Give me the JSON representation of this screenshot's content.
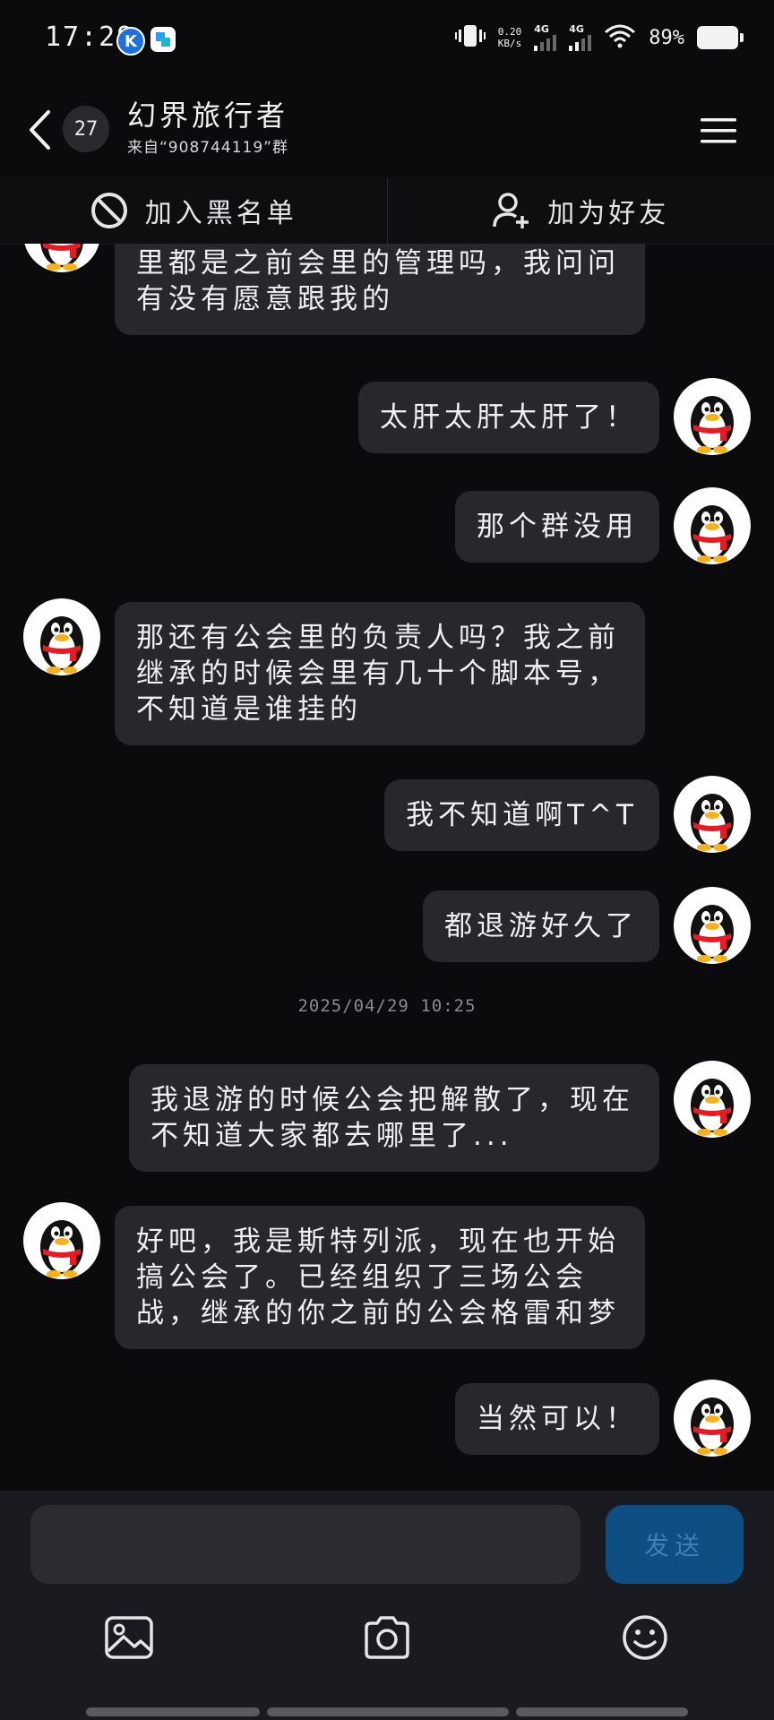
{
  "status_bar": {
    "time": "17:29",
    "net_speed_value": "0.20",
    "net_speed_unit": "KB/s",
    "network_1": "4G",
    "network_2": "4G",
    "battery": "89%"
  },
  "header": {
    "unread_count": "27",
    "title": "幻界旅行者",
    "subtitle": "来自“908744119”群"
  },
  "actions": {
    "block_label": "加入黑名单",
    "add_friend_label": "加为好友"
  },
  "messages": [
    {
      "side": "left",
      "text": "里都是之前会里的管理吗，我问问\n有没有愿意跟我的"
    },
    {
      "side": "right",
      "text": "太肝太肝太肝了！"
    },
    {
      "side": "right",
      "text": "那个群没用"
    },
    {
      "side": "left",
      "text": "那还有公会里的负责人吗？我之前\n继承的时候会里有几十个脚本号，\n不知道是谁挂的"
    },
    {
      "side": "right",
      "text": "我不知道啊T^T"
    },
    {
      "side": "right",
      "text": "都退游好久了"
    },
    {
      "side": "right",
      "text": "我退游的时候公会把解散了，现在\n不知道大家都去哪里了..."
    },
    {
      "side": "left",
      "text": "好吧，我是斯特列派，现在也开始\n搞公会了。已经组织了三场公会\n战，继承的你之前的公会格雷和梦"
    },
    {
      "side": "right",
      "text": "当然可以！"
    }
  ],
  "timestamp": "2025/04/29 10:25",
  "input": {
    "placeholder": "",
    "send_label": "发送"
  },
  "colors": {
    "background": "#0b0b0e",
    "bubble": "#28282c",
    "send_button": "#0f4e82",
    "input_bar": "#1a1b20"
  }
}
